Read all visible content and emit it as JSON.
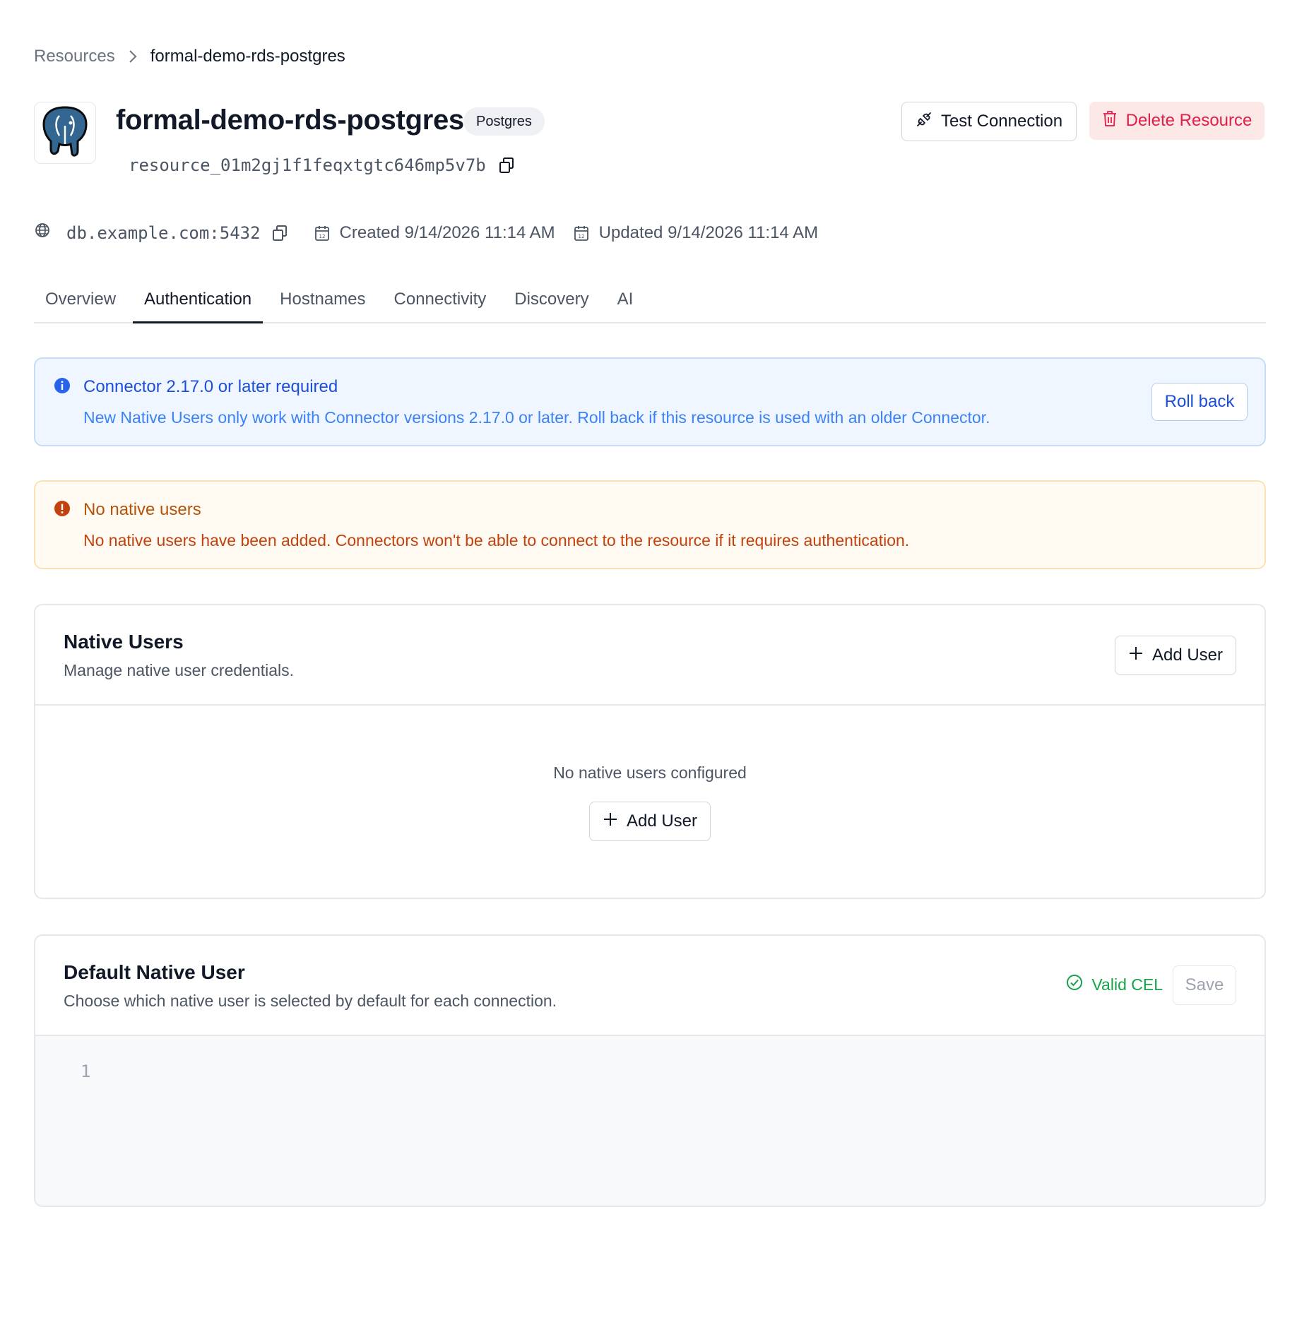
{
  "breadcrumb": {
    "parent": "Resources",
    "current": "formal-demo-rds-postgres"
  },
  "resource": {
    "name": "formal-demo-rds-postgres",
    "type_badge": "Postgres",
    "id": "resource_01m2gj1f1feqxtgtc646mp5v7b",
    "hostname": "db.example.com:5432",
    "created": "Created 9/14/2026 11:14 AM",
    "updated": "Updated 9/14/2026 11:14 AM",
    "logo_icon": "postgres-elephant-icon"
  },
  "actions": {
    "test_connection": "Test Connection",
    "delete_resource": "Delete Resource"
  },
  "tabs": [
    {
      "label": "Overview",
      "active": false
    },
    {
      "label": "Authentication",
      "active": true
    },
    {
      "label": "Hostnames",
      "active": false
    },
    {
      "label": "Connectivity",
      "active": false
    },
    {
      "label": "Discovery",
      "active": false
    },
    {
      "label": "AI",
      "active": false
    }
  ],
  "alerts": {
    "info": {
      "title": "Connector 2.17.0 or later required",
      "description": "New Native Users only work with Connector versions 2.17.0 or later. Roll back if this resource is used with an older Connector.",
      "button": "Roll back"
    },
    "warning": {
      "title": "No native users",
      "description": "No native users have been added. Connectors won't be able to connect to the resource if it requires authentication."
    }
  },
  "native_users": {
    "title": "Native Users",
    "description": "Manage native user credentials.",
    "add_button": "Add User",
    "empty_text": "No native users configured",
    "empty_add_button": "Add User"
  },
  "default_native_user": {
    "title": "Default Native User",
    "description": "Choose which native user is selected by default for each connection.",
    "status": "Valid CEL",
    "save_button": "Save",
    "editor_line_number": "1"
  },
  "colors": {
    "info_accent": "#1d4ed8",
    "warning_accent": "#b45309",
    "danger": "#e11d48",
    "success": "#16a34a"
  }
}
